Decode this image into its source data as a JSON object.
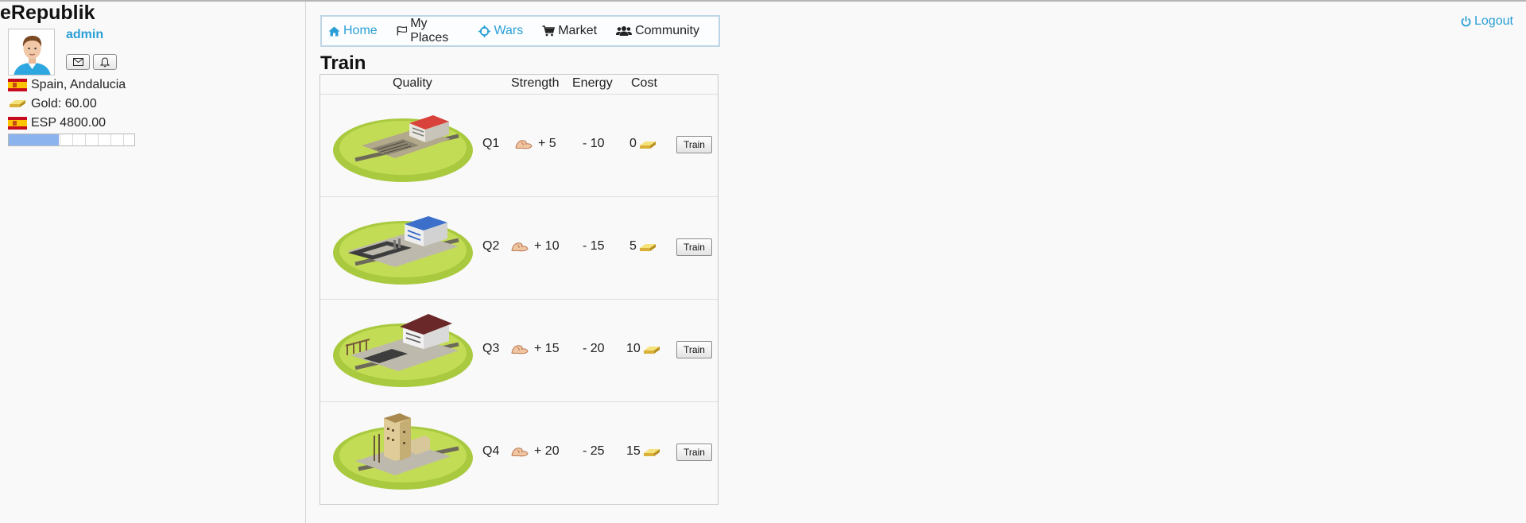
{
  "app": {
    "brand": "eRepublik"
  },
  "user": {
    "name": "admin",
    "location": "Spain, Andalucia",
    "gold": "Gold: 60.00",
    "currency": "ESP 4800.00",
    "progress_fraction": 0.4
  },
  "nav": {
    "items": [
      {
        "label": "Home",
        "icon": "home-icon",
        "color": "#2a9fd6"
      },
      {
        "label": "My Places",
        "icon": "flag-icon",
        "color": "#222222"
      },
      {
        "label": "Wars",
        "icon": "crosshair-icon",
        "color": "#2a9fd6"
      },
      {
        "label": "Market",
        "icon": "cart-icon",
        "color": "#222222"
      },
      {
        "label": "Community",
        "icon": "users-icon",
        "color": "#222222"
      }
    ],
    "logout": "Logout"
  },
  "page": {
    "title": "Train"
  },
  "table": {
    "headers": [
      "Quality",
      "Strength",
      "Energy",
      "Cost"
    ],
    "rows": [
      {
        "quality": "Q1",
        "strength": "+ 5",
        "energy": "- 10",
        "cost": "0",
        "button": "Train"
      },
      {
        "quality": "Q2",
        "strength": "+ 10",
        "energy": "- 15",
        "cost": "5",
        "button": "Train"
      },
      {
        "quality": "Q3",
        "strength": "+ 15",
        "energy": "- 20",
        "cost": "10",
        "button": "Train"
      },
      {
        "quality": "Q4",
        "strength": "+ 20",
        "energy": "- 25",
        "cost": "15",
        "button": "Train"
      }
    ]
  },
  "colors": {
    "accent": "#2a9fd6",
    "progress": "#8bb3ee",
    "nav_border": "#bed6e5"
  }
}
